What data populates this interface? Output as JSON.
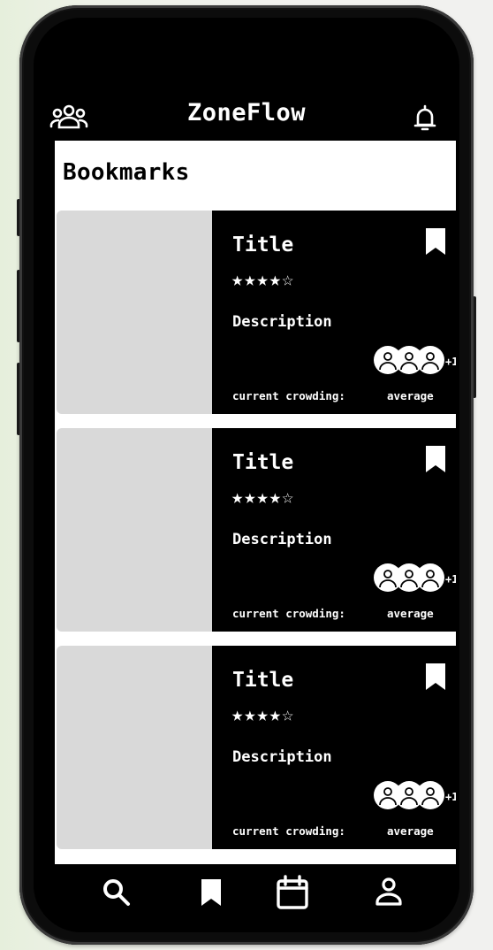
{
  "app": {
    "title": "ZoneFlow"
  },
  "header": {
    "left_icon": "users-icon",
    "right_icon": "bell-icon"
  },
  "page": {
    "title": "Bookmarks"
  },
  "cards": [
    {
      "title": "Title",
      "stars": "★★★★☆",
      "rating": 4,
      "description": "Description",
      "crowd_extra": "+1",
      "crowding_label": "current crowding:",
      "crowding_value": "average"
    },
    {
      "title": "Title",
      "stars": "★★★★☆",
      "rating": 4,
      "description": "Description",
      "crowd_extra": "+1",
      "crowding_label": "current crowding:",
      "crowding_value": "average"
    },
    {
      "title": "Title",
      "stars": "★★★★☆",
      "rating": 4,
      "description": "Description",
      "crowd_extra": "+1",
      "crowding_label": "current crowding:",
      "crowding_value": "average"
    }
  ],
  "bottom_nav": [
    "search-icon",
    "bookmark-icon",
    "calendar-icon",
    "profile-icon"
  ],
  "colors": {
    "screen_bg": "#000000",
    "content_bg": "#ffffff",
    "image_placeholder": "#d9d9d9",
    "text_light": "#ffffff"
  }
}
